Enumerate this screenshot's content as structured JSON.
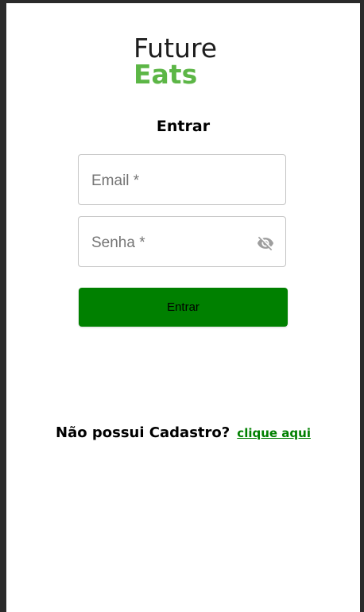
{
  "logo": {
    "line1": "Future",
    "line2": "Eats"
  },
  "title": "Entrar",
  "fields": {
    "email": {
      "placeholder": "Email *"
    },
    "password": {
      "placeholder": "Senha *",
      "icon": "eye-off-icon"
    }
  },
  "button": {
    "label": "Entrar"
  },
  "signup": {
    "question": "Não possui Cadastro?",
    "link": "clique aqui"
  },
  "colors": {
    "brand_green": "#5cb646",
    "button_green": "#008000",
    "link_green": "#008000"
  }
}
